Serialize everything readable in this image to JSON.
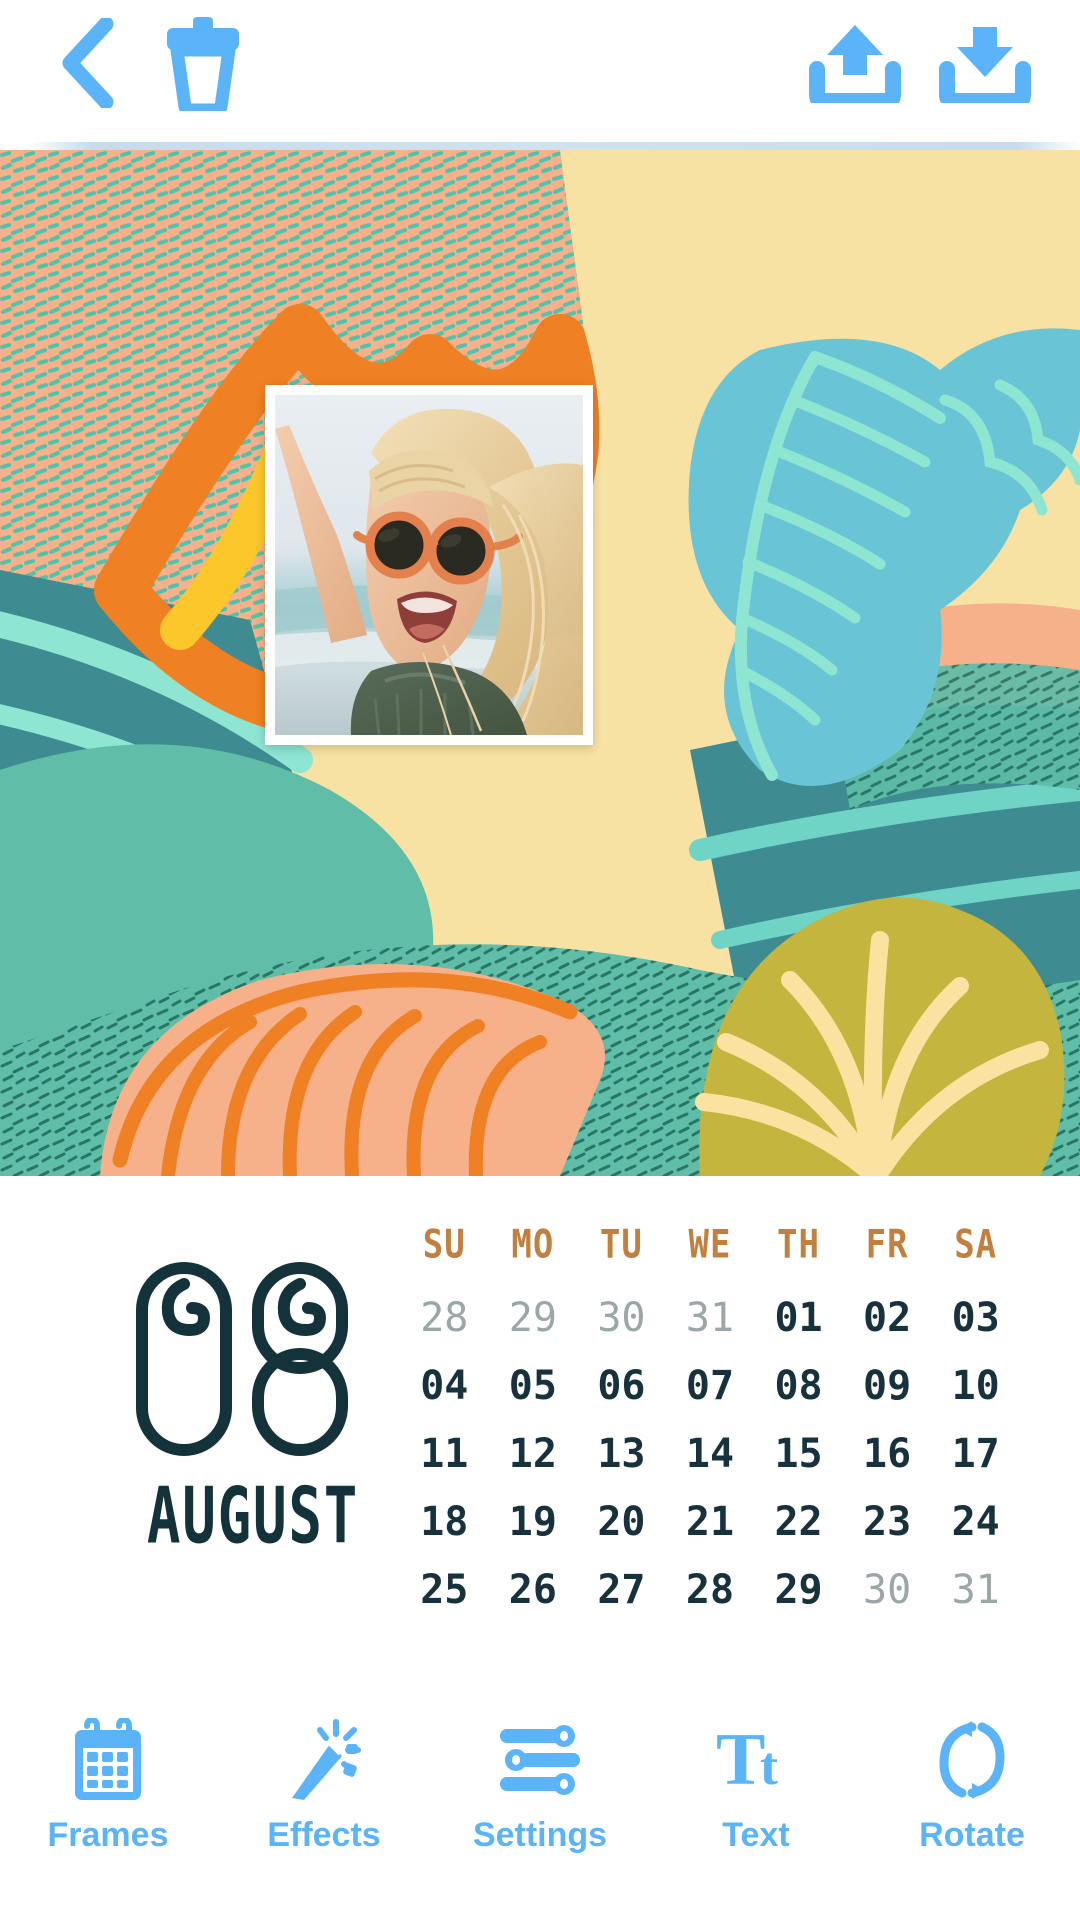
{
  "header": {
    "back_icon": "chevron-left-icon",
    "delete_icon": "trash-icon",
    "upload_icon": "upload-icon",
    "download_icon": "download-icon",
    "accent_color": "#5ab4f7"
  },
  "canvas": {
    "theme": "beach-summer-collage",
    "background_color": "#f7e2a4",
    "decor": [
      "starfish",
      "conch-shell",
      "scallop-shell",
      "fan-shell",
      "teal-brush-strokes",
      "peach-texture-patch",
      "green-speckled-patch"
    ],
    "palette": {
      "peach": "#f6b08a",
      "orange": "#ef8023",
      "yellow": "#fbc72b",
      "cream": "#fbe2a0",
      "teal": "#5fbda8",
      "deep_teal": "#3e8c91",
      "sky": "#69c4d6",
      "mint": "#8ee5d2",
      "olive": "#c4b53f"
    },
    "photo": {
      "alt": "young girl in orange round sunglasses at the beach",
      "frame_color": "#ffffff"
    }
  },
  "calendar": {
    "month_number": "08",
    "month_name": "AUGUST",
    "weekday_headers": [
      "SU",
      "MO",
      "TU",
      "WE",
      "TH",
      "FR",
      "SA"
    ],
    "header_color": "#c1803f",
    "day_color": "#17323c",
    "muted_color": "#9aa6a8",
    "weeks": [
      [
        {
          "d": "28",
          "muted": true
        },
        {
          "d": "29",
          "muted": true
        },
        {
          "d": "30",
          "muted": true
        },
        {
          "d": "31",
          "muted": true
        },
        {
          "d": "01",
          "muted": false
        },
        {
          "d": "02",
          "muted": false
        },
        {
          "d": "03",
          "muted": false
        }
      ],
      [
        {
          "d": "04",
          "muted": false
        },
        {
          "d": "05",
          "muted": false
        },
        {
          "d": "06",
          "muted": false
        },
        {
          "d": "07",
          "muted": false
        },
        {
          "d": "08",
          "muted": false
        },
        {
          "d": "09",
          "muted": false
        },
        {
          "d": "10",
          "muted": false
        }
      ],
      [
        {
          "d": "11",
          "muted": false
        },
        {
          "d": "12",
          "muted": false
        },
        {
          "d": "13",
          "muted": false
        },
        {
          "d": "14",
          "muted": false
        },
        {
          "d": "15",
          "muted": false
        },
        {
          "d": "16",
          "muted": false
        },
        {
          "d": "17",
          "muted": false
        }
      ],
      [
        {
          "d": "18",
          "muted": false
        },
        {
          "d": "19",
          "muted": false
        },
        {
          "d": "20",
          "muted": false
        },
        {
          "d": "21",
          "muted": false
        },
        {
          "d": "22",
          "muted": false
        },
        {
          "d": "23",
          "muted": false
        },
        {
          "d": "24",
          "muted": false
        }
      ],
      [
        {
          "d": "25",
          "muted": false
        },
        {
          "d": "26",
          "muted": false
        },
        {
          "d": "27",
          "muted": false
        },
        {
          "d": "28",
          "muted": false
        },
        {
          "d": "29",
          "muted": false
        },
        {
          "d": "30",
          "muted": true
        },
        {
          "d": "31",
          "muted": true
        }
      ]
    ]
  },
  "toolbar": {
    "accent_color": "#5ab4f7",
    "items": [
      {
        "label": "Frames",
        "icon": "calendar-icon"
      },
      {
        "label": "Effects",
        "icon": "magic-wand-icon"
      },
      {
        "label": "Settings",
        "icon": "sliders-icon"
      },
      {
        "label": "Text",
        "icon": "text-tt-icon"
      },
      {
        "label": "Rotate",
        "icon": "rotate-icon"
      }
    ]
  }
}
